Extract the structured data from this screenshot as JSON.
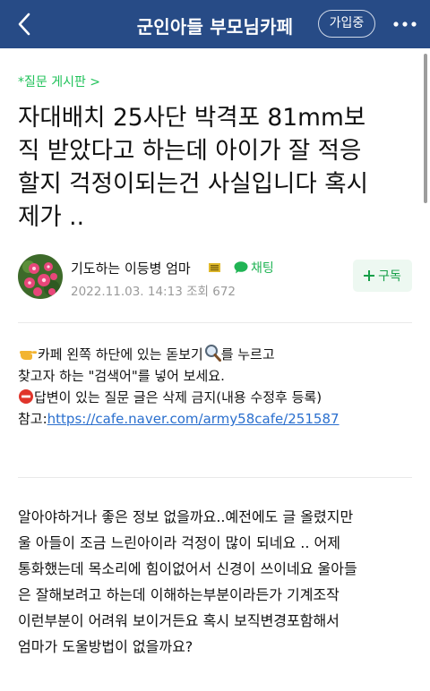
{
  "header": {
    "cafe_name": "군인아들 부모님카페",
    "join_label": "가입중",
    "bg_color": "#274b86"
  },
  "post": {
    "board_label": "*질문 게시판 >",
    "title": "자대배치 25사단 박격포 81mm보직 받았다고 하는데 아이가 잘 적응할지 걱정이되는건 사실입니다 혹시제가 ..",
    "title_lines": [
      "자대배치 25사단 박격포 81mm보",
      "직 받았다고 하는데 아이가 잘 적응",
      "할지 걱정이되는건 사실입니다 혹시",
      "제가 .."
    ],
    "author": "기도하는 이등병 엄마",
    "chat_label": "채팅",
    "date": "2022.11.03. 14:13",
    "views_label": "조회 672",
    "subscribe_label": "구독"
  },
  "notice": {
    "line1": "카페 왼쪽 하단에 있는 돋보기",
    "line1_tail": "를 누르고",
    "line2": "찾고자 하는 \"검색어\"를 넣어 보세요.",
    "line3": "답변이 있는 질문 글은 삭제 금지(내용 수정후 등록)",
    "line4_label": "참고:",
    "line4_link": "https://cafe.naver.com/army58cafe/251587"
  },
  "content": {
    "lines": [
      "알아야하거나  좋은 정보 없을까요..예전에도 글 올렸지만",
      "울 아들이  조금 느린아이라 걱정이 많이  되네요 .. 어제",
      "통화했는데  목소리에 힘이없어서 신경이 쓰이네요 울아들",
      "은 잘해보려고 하는데  이해하는부분이라든가  기계조작",
      "이런부분이  어려워 보이거든요  혹시 보직변경포함해서",
      "엄마가   도울방법이  없을까요?"
    ]
  },
  "icons": {
    "back": "chevron-left-icon",
    "more": "more-dots-icon",
    "chat": "chat-bubble-icon",
    "grade": "grade-badge-icon",
    "pointing": "pointing-hand-icon",
    "magnifier": "magnifier-icon",
    "no_entry": "no-entry-icon"
  }
}
